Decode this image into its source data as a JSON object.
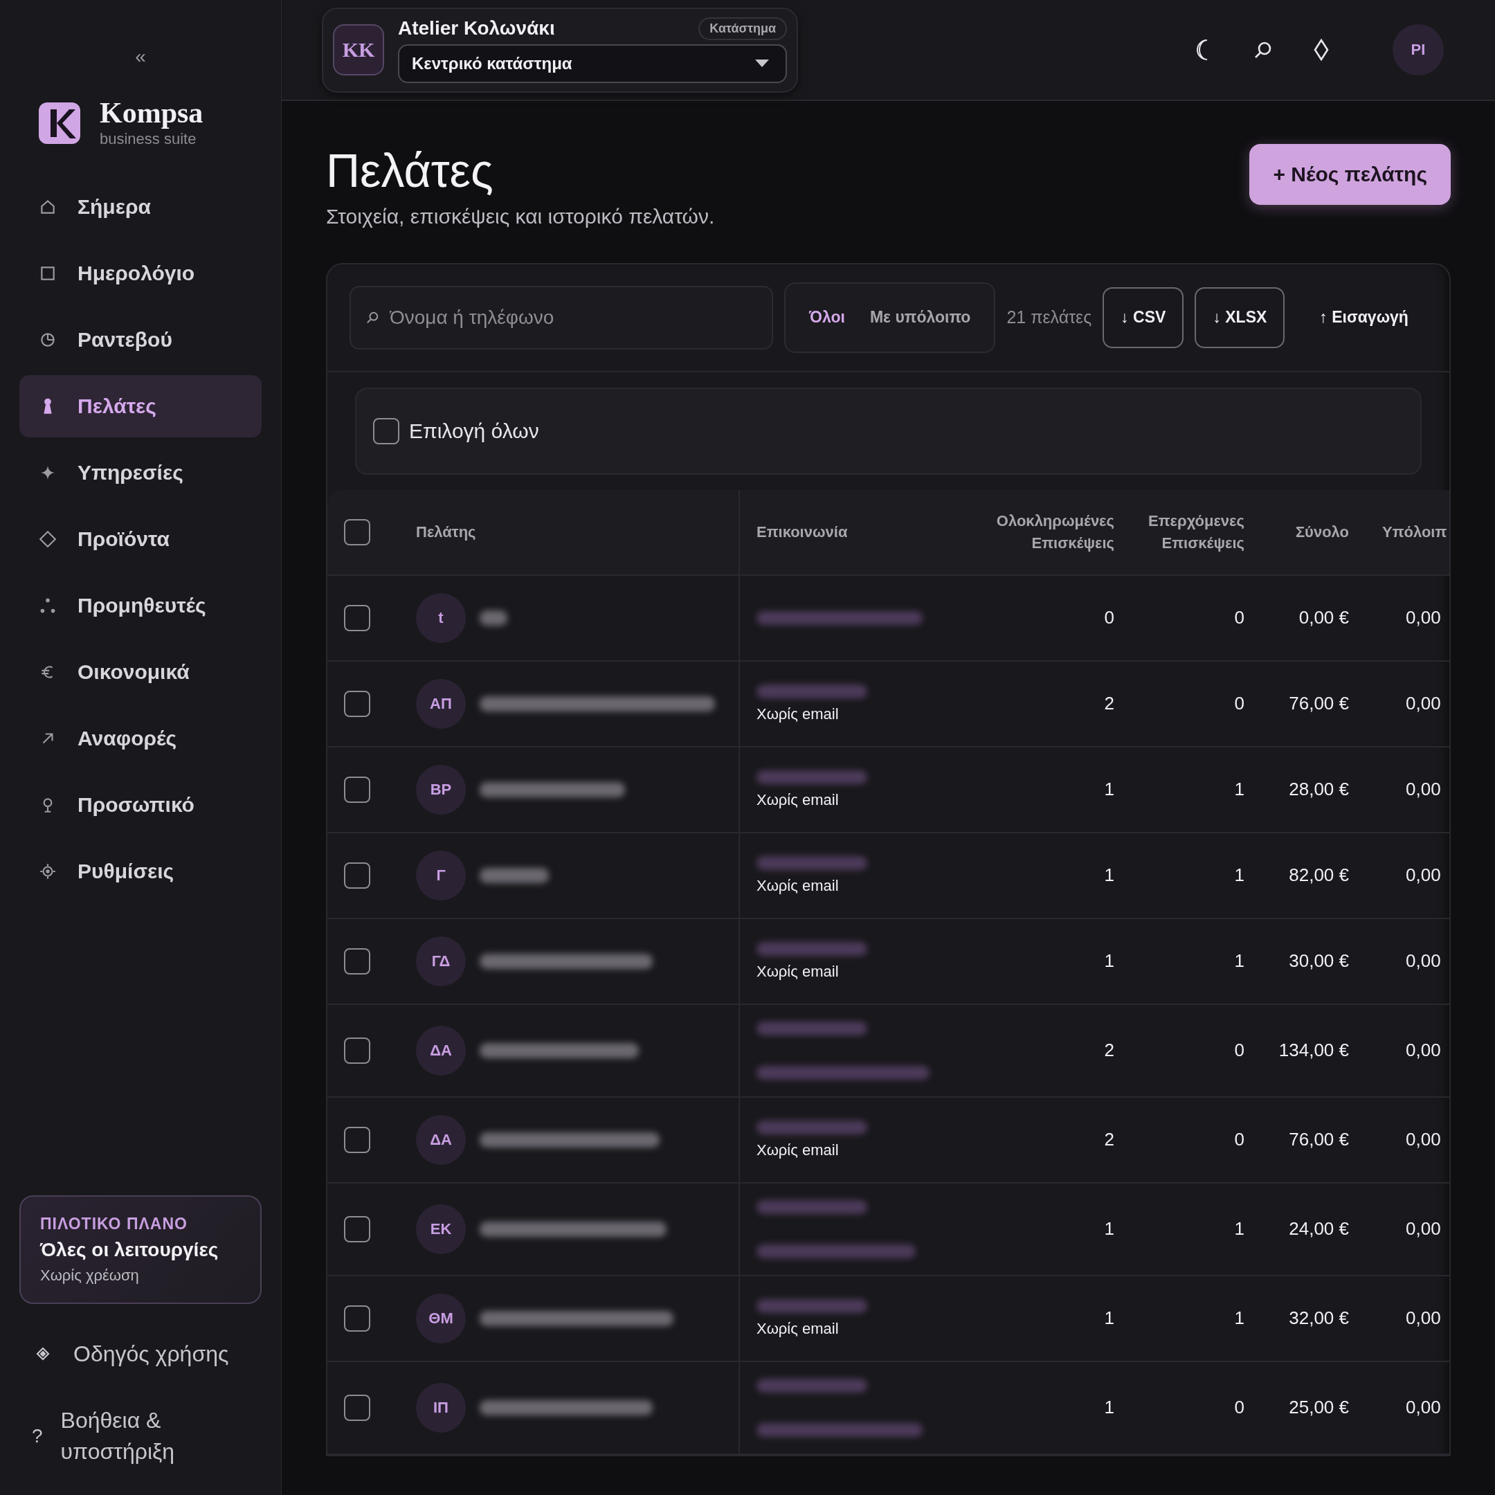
{
  "sidebar": {
    "collapse": "«",
    "brand": {
      "name": "Kompsa",
      "tagline": "business suite"
    },
    "items": [
      {
        "label": "Σήμερα",
        "selected": false
      },
      {
        "label": "Ημερολόγιο",
        "selected": false
      },
      {
        "label": "Ραντεβού",
        "selected": false
      },
      {
        "label": "Πελάτες",
        "selected": true
      },
      {
        "label": "Υπηρεσίες",
        "selected": false
      },
      {
        "label": "Προϊόντα",
        "selected": false
      },
      {
        "label": "Προμηθευτές",
        "selected": false
      },
      {
        "label": "Οικονομικά",
        "selected": false
      },
      {
        "label": "Αναφορές",
        "selected": false
      },
      {
        "label": "Προσωπικό",
        "selected": false
      },
      {
        "label": "Ρυθμίσεις",
        "selected": false
      }
    ],
    "plan": {
      "eyebrow": "ΠΙΛΟΤΙΚΟ ΠΛΑΝΟ",
      "title": "Όλες οι λειτουργίες",
      "note": "Χωρίς χρέωση"
    },
    "footer_links": [
      {
        "label": "Οδηγός χρήσης"
      },
      {
        "label": "Βοήθεια & υποστήριξη",
        "icon_text": "?"
      }
    ]
  },
  "topbar": {
    "org": {
      "initials": "KK",
      "name": "Atelier Κολωνάκι",
      "badge": "Κατάστημα",
      "store": "Κεντρικό κατάστημα"
    },
    "user_initials": "PI"
  },
  "page": {
    "title": "Πελάτες",
    "subtitle": "Στοιχεία, επισκέψεις και ιστορικό πελατών.",
    "new_button": "+ Νέος πελάτης"
  },
  "toolbar": {
    "search": {
      "placeholder": "Όνομα ή τηλέφωνο"
    },
    "filters": [
      {
        "label": "Όλοι",
        "selected": true
      },
      {
        "label": "Με υπόλοιπο",
        "selected": false
      }
    ],
    "count": "21 πελάτες",
    "actions": [
      {
        "label": "↓ CSV",
        "kind": "outlined"
      },
      {
        "label": "↓ XLSX",
        "kind": "outlined"
      },
      {
        "label": "↑ Εισαγωγή",
        "kind": "plain"
      }
    ]
  },
  "select_all": {
    "label": "Επιλογή όλων",
    "checked": false
  },
  "table": {
    "header_checked": false,
    "columns": [
      "Πελάτης",
      "Επικοινωνία",
      "Ολοκληρωμένες Επισκέψεις",
      "Επερχόμενες Επισκέψεις",
      "Σύνολο",
      "Υπόλοιπ"
    ],
    "rows": [
      {
        "checked": false,
        "initials": "t",
        "contact": [
          {
            "kind": "blurred"
          }
        ],
        "completed": "0",
        "upcoming": "0",
        "total": "0,00 €",
        "balance": "0,00"
      },
      {
        "checked": false,
        "initials": "ΑΠ",
        "contact": [
          {
            "kind": "blurred"
          },
          {
            "kind": "text",
            "text": "Χωρίς email"
          }
        ],
        "completed": "2",
        "upcoming": "0",
        "total": "76,00 €",
        "balance": "0,00"
      },
      {
        "checked": false,
        "initials": "ΒΡ",
        "contact": [
          {
            "kind": "blurred"
          },
          {
            "kind": "text",
            "text": "Χωρίς email"
          }
        ],
        "completed": "1",
        "upcoming": "1",
        "total": "28,00 €",
        "balance": "0,00"
      },
      {
        "checked": false,
        "initials": "Γ",
        "contact": [
          {
            "kind": "blurred"
          },
          {
            "kind": "text",
            "text": "Χωρίς email"
          }
        ],
        "completed": "1",
        "upcoming": "1",
        "total": "82,00 €",
        "balance": "0,00"
      },
      {
        "checked": false,
        "initials": "ΓΔ",
        "contact": [
          {
            "kind": "blurred"
          },
          {
            "kind": "text",
            "text": "Χωρίς email"
          }
        ],
        "completed": "1",
        "upcoming": "1",
        "total": "30,00 €",
        "balance": "0,00"
      },
      {
        "checked": false,
        "initials": "ΔΑ",
        "contact": [
          {
            "kind": "blurred"
          },
          {
            "kind": "blurred"
          }
        ],
        "completed": "2",
        "upcoming": "0",
        "total": "134,00 €",
        "balance": "0,00"
      },
      {
        "checked": false,
        "initials": "ΔΑ",
        "contact": [
          {
            "kind": "blurred"
          },
          {
            "kind": "text",
            "text": "Χωρίς email"
          }
        ],
        "completed": "2",
        "upcoming": "0",
        "total": "76,00 €",
        "balance": "0,00"
      },
      {
        "checked": false,
        "initials": "ΕΚ",
        "contact": [
          {
            "kind": "blurred"
          },
          {
            "kind": "blurred"
          }
        ],
        "completed": "1",
        "upcoming": "1",
        "total": "24,00 €",
        "balance": "0,00"
      },
      {
        "checked": false,
        "initials": "ΘΜ",
        "contact": [
          {
            "kind": "blurred"
          },
          {
            "kind": "text",
            "text": "Χωρίς email"
          }
        ],
        "completed": "1",
        "upcoming": "1",
        "total": "32,00 €",
        "balance": "0,00"
      },
      {
        "checked": false,
        "initials": "ΙΠ",
        "contact": [
          {
            "kind": "blurred"
          },
          {
            "kind": "blurred"
          }
        ],
        "completed": "1",
        "upcoming": "0",
        "total": "25,00 €",
        "balance": "0,00"
      }
    ]
  }
}
